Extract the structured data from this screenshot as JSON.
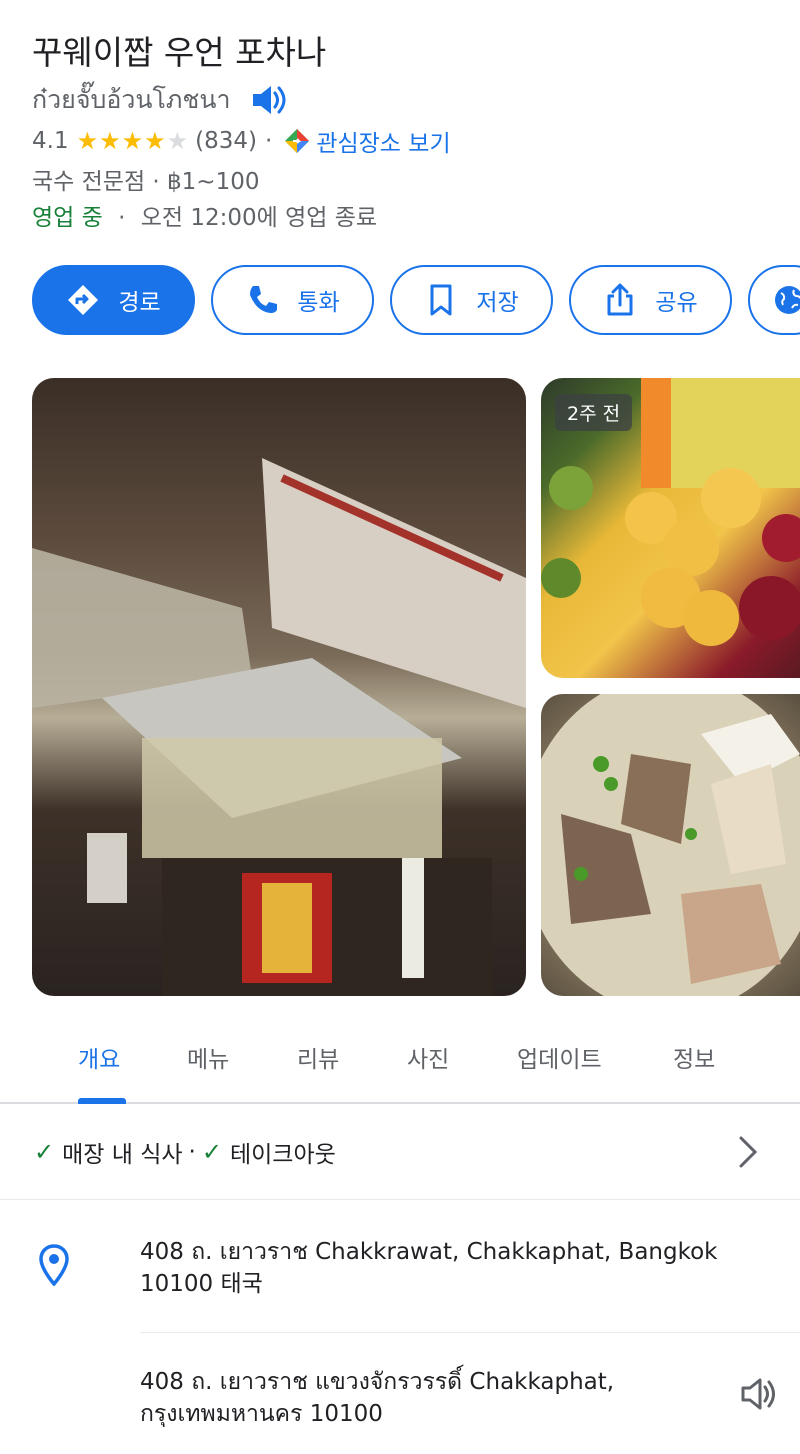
{
  "place": {
    "name": "꾸웨이짭 우언 포차나",
    "name_native": "ก๋วยจั๊บอ้วนโภชนา",
    "rating": "4.1",
    "stars_filled": 4,
    "stars_total": 5,
    "review_count": "(834)",
    "poi_link": "관심장소 보기",
    "category": "국수 전문점 · ฿1~100",
    "status_open": "영업 중",
    "status_hours": "오전 12:00에 영업 종료"
  },
  "actions": {
    "directions": "경로",
    "call": "통화",
    "save": "저장",
    "share": "공유"
  },
  "photos": {
    "badge": "2주 전"
  },
  "tabs": {
    "overview": "개요",
    "menu": "메뉴",
    "reviews": "리뷰",
    "photos": "사진",
    "updates": "업데이트",
    "about": "정보"
  },
  "services": {
    "dine_in": "매장 내 식사",
    "separator": "·",
    "takeout": "테이크아웃"
  },
  "address": {
    "line_en": "408 ถ. เยาวราช Chakkrawat, Chakkaphat, Bangkok 10100 태국",
    "line_th": "408 ถ. เยาวราช แขวงจักรวรรดิ์ Chakkaphat, กรุงเทพมหานคร 10100"
  },
  "colors": {
    "accent": "#1a73e8",
    "open": "#188038",
    "star": "#fbbc04"
  }
}
